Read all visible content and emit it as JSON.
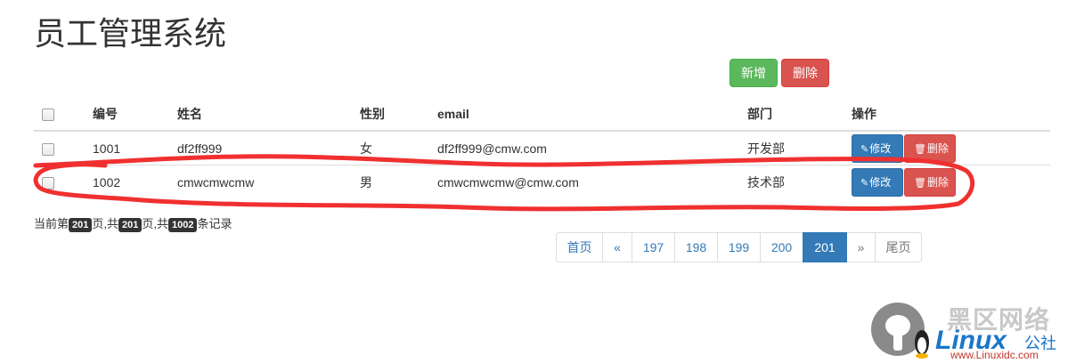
{
  "page": {
    "title": "员工管理系统"
  },
  "toolbar": {
    "add_label": "新增",
    "delete_label": "删除"
  },
  "table": {
    "headers": {
      "id": "编号",
      "name": "姓名",
      "gender": "性别",
      "email": "email",
      "dept": "部门",
      "ops": "操作"
    },
    "rows": [
      {
        "id": "1001",
        "name": "df2ff999",
        "gender": "女",
        "email": "df2ff999@cmw.com",
        "dept": "开发部"
      },
      {
        "id": "1002",
        "name": "cmwcmwcmw",
        "gender": "男",
        "email": "cmwcmwcmw@cmw.com",
        "dept": "技术部"
      }
    ],
    "edit_label": "修改",
    "delete_label": "删除"
  },
  "page_info": {
    "prefix": "当前第",
    "current": "201",
    "mid1": "页,共",
    "total_pages": "201",
    "mid2": "页,共",
    "total_records": "1002",
    "suffix": "条记录"
  },
  "pagination": {
    "items": [
      "首页",
      "«",
      "197",
      "198",
      "199",
      "200",
      "201",
      "»",
      "尾页"
    ],
    "active": "201"
  },
  "annotation": {
    "color": "#f03030"
  },
  "watermark": {
    "cn": "黑区网络",
    "brand": "Linux",
    "suffix": "公社",
    "url": "www.Linuxidc.com"
  }
}
